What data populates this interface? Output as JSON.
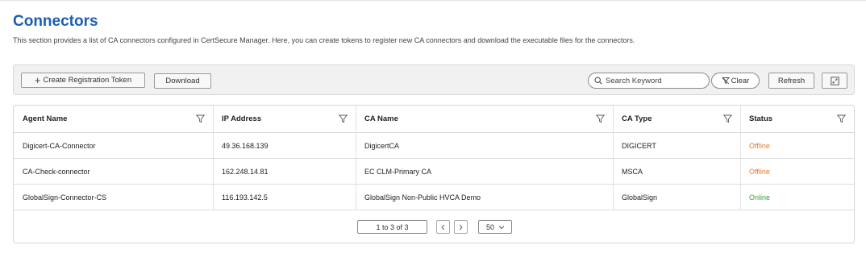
{
  "page": {
    "title": "Connectors",
    "description": "This section provides a list of CA connectors configured in CertSecure Manager. Here, you can create tokens to register new CA connectors and download the executable files for the connectors."
  },
  "toolbar": {
    "create_label": "Create Registration Token",
    "download_label": "Download",
    "search_placeholder": "Search Keyword",
    "clear_label": "Clear",
    "refresh_label": "Refresh",
    "expand_icon": "expand-icon"
  },
  "table": {
    "columns": [
      "Agent Name",
      "IP Address",
      "CA Name",
      "CA Type",
      "Status"
    ],
    "rows": [
      {
        "agent_name": "Digicert-CA-Connector",
        "ip": "49.36.168.139",
        "ca_name": "DigicertCA",
        "ca_type": "DIGICERT",
        "status": "Offline"
      },
      {
        "agent_name": "CA-Check-connector",
        "ip": "162.248.14.81",
        "ca_name": "EC CLM-Primary CA",
        "ca_type": "MSCA",
        "status": "Offline"
      },
      {
        "agent_name": "GlobalSign-Connector-CS",
        "ip": "116.193.142.5",
        "ca_name": "GlobalSign Non-Public HVCA Demo",
        "ca_type": "GlobalSign",
        "status": "Online"
      }
    ]
  },
  "pagination": {
    "range_label": "1 to 3 of 3",
    "page_size": "50"
  },
  "colors": {
    "title": "#1a5fb4",
    "offline": "#e07b39",
    "online": "#3aa53a"
  }
}
